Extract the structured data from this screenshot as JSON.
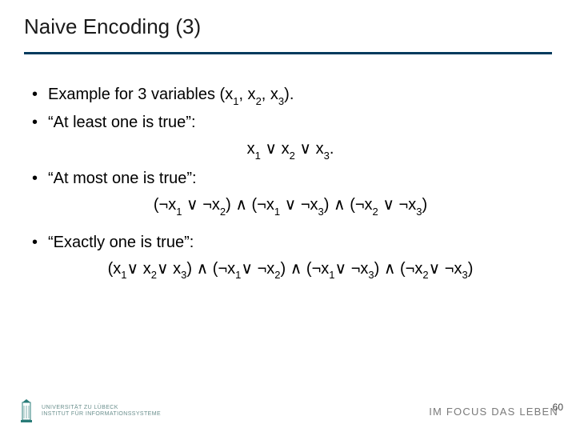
{
  "title": "Naive Encoding (3)",
  "bullets": {
    "b1_pre": "Example for 3 variables (x",
    "b1_s1": "1",
    "b1_m1": ", x",
    "b1_s2": "2",
    "b1_m2": ", x",
    "b1_s3": "3",
    "b1_post": ").",
    "b2": "“At least one is true”:",
    "f1_a": "x",
    "f1_s1": "1",
    "f1_b": " ∨ x",
    "f1_s2": "2",
    "f1_c": " ∨ x",
    "f1_s3": "3",
    "f1_d": ".",
    "b3": "“At most one is true”:",
    "f2_a": "(¬x",
    "f2_s1": "1",
    "f2_b": " ∨  ¬x",
    "f2_s2": "2",
    "f2_c": ") ∧ (¬x",
    "f2_s3": "1",
    "f2_d": " ∨  ¬x",
    "f2_s4": "3",
    "f2_e": ") ∧ (¬x",
    "f2_s5": "2",
    "f2_f": " ∨  ¬x",
    "f2_s6": "3",
    "f2_g": ")",
    "b4": "“Exactly one is true”:",
    "f3_a": "(x",
    "f3_s1": "1",
    "f3_b": "∨ x",
    "f3_s2": "2",
    "f3_c": "∨ x",
    "f3_s3": "3",
    "f3_d": ") ∧ (¬x",
    "f3_s4": "1",
    "f3_e": "∨ ¬x",
    "f3_s5": "2",
    "f3_f": ") ∧ (¬x",
    "f3_s6": "1",
    "f3_g": "∨ ¬x",
    "f3_s7": "3",
    "f3_h": ") ∧ (¬x",
    "f3_s8": "2",
    "f3_i": "∨ ¬x",
    "f3_s9": "3",
    "f3_j": ")"
  },
  "footer": {
    "uni_line1": "UNIVERSITÄT ZU LÜBECK",
    "uni_line2": "INSTITUT FÜR INFORMATIONSSYSTEME",
    "tagline": "IM FOCUS DAS LEBEN",
    "page": "60"
  }
}
